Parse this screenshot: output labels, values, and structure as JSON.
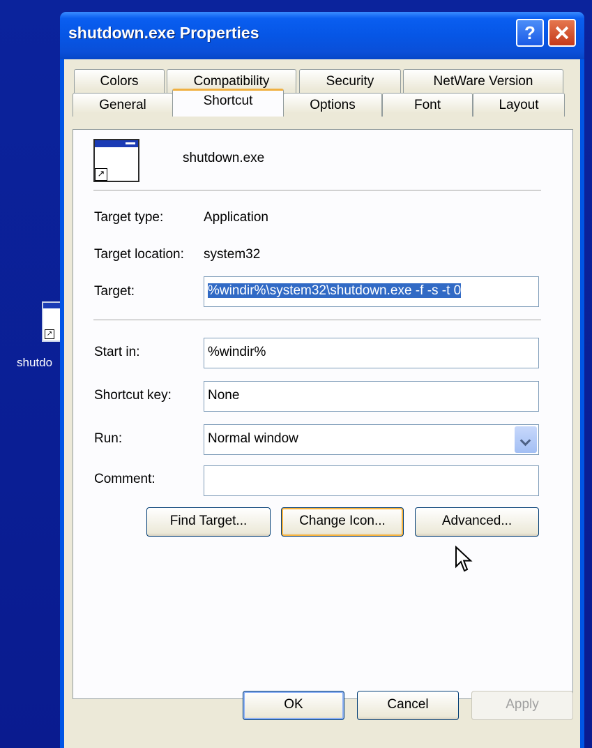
{
  "desktop": {
    "icon_label": "shutdo"
  },
  "window": {
    "title": "shutdown.exe Properties",
    "help_label": "?",
    "tabs_row1": [
      "Colors",
      "Compatibility",
      "Security",
      "NetWare Version"
    ],
    "tabs_row2": [
      "General",
      "Shortcut",
      "Options",
      "Font",
      "Layout"
    ],
    "active_tab": "Shortcut"
  },
  "shortcut": {
    "name": "shutdown.exe",
    "target_type_label": "Target type:",
    "target_type": "Application",
    "target_location_label": "Target location:",
    "target_location": "system32",
    "target_label": "Target:",
    "target_value": "%windir%\\system32\\shutdown.exe -f -s -t 0",
    "start_in_label": "Start in:",
    "start_in_value": "%windir%",
    "shortcut_key_label": "Shortcut key:",
    "shortcut_key_value": "None",
    "run_label": "Run:",
    "run_value": "Normal window",
    "comment_label": "Comment:",
    "comment_value": ""
  },
  "buttons": {
    "find_target": "Find Target...",
    "change_icon": "Change Icon...",
    "advanced": "Advanced...",
    "ok": "OK",
    "cancel": "Cancel",
    "apply": "Apply"
  }
}
